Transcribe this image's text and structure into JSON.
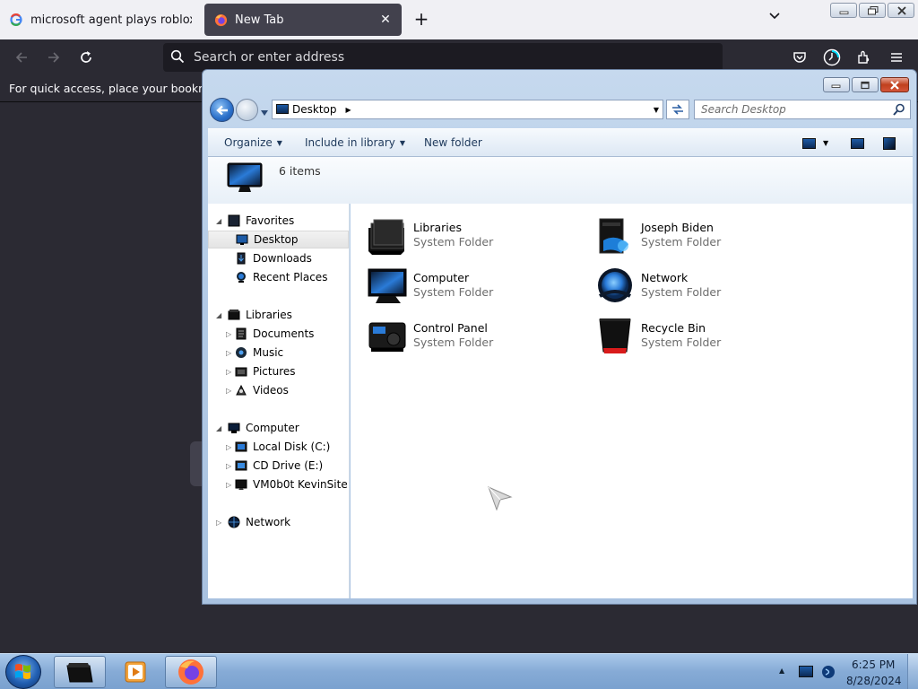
{
  "browser": {
    "tabs": [
      {
        "title": "microsoft agent plays roblox - G",
        "favicon": "google-g-icon",
        "active": false
      },
      {
        "title": "New Tab",
        "favicon": "firefox-icon",
        "active": true
      }
    ],
    "url_placeholder": "Search or enter address",
    "bookmarks_message": "For quick access, place your bookmarks here on the bookmarks toolbar."
  },
  "explorer": {
    "address": {
      "location": "Desktop"
    },
    "search_placeholder": "Search Desktop",
    "commands": {
      "organize": "Organize",
      "include": "Include in library",
      "new_folder": "New folder"
    },
    "item_count": "6 items",
    "nav": {
      "favorites": {
        "label": "Favorites",
        "items": [
          {
            "label": "Desktop",
            "selected": true
          },
          {
            "label": "Downloads"
          },
          {
            "label": "Recent Places"
          }
        ]
      },
      "libraries": {
        "label": "Libraries",
        "items": [
          {
            "label": "Documents"
          },
          {
            "label": "Music"
          },
          {
            "label": "Pictures"
          },
          {
            "label": "Videos"
          }
        ]
      },
      "computer": {
        "label": "Computer",
        "items": [
          {
            "label": "Local Disk (C:)"
          },
          {
            "label": "CD Drive (E:)"
          },
          {
            "label": "VM0b0t KevinSite"
          }
        ]
      },
      "network": {
        "label": "Network"
      }
    },
    "items": [
      {
        "name": "Libraries",
        "type": "System Folder",
        "icon": "libraries-icon"
      },
      {
        "name": "Joseph Biden",
        "type": "System Folder",
        "icon": "user-folder-icon"
      },
      {
        "name": "Computer",
        "type": "System Folder",
        "icon": "computer-icon"
      },
      {
        "name": "Network",
        "type": "System Folder",
        "icon": "network-icon"
      },
      {
        "name": "Control Panel",
        "type": "System Folder",
        "icon": "control-panel-icon"
      },
      {
        "name": "Recycle Bin",
        "type": "System Folder",
        "icon": "recycle-bin-icon"
      }
    ]
  },
  "taskbar": {
    "time": "6:25 PM",
    "date": "8/28/2024"
  },
  "colors": {
    "firefox_bg": "#2b2a33",
    "explorer_frame": "#b4cbe6",
    "taskbar": "#86abd6",
    "accent": "#1d5ba6"
  }
}
